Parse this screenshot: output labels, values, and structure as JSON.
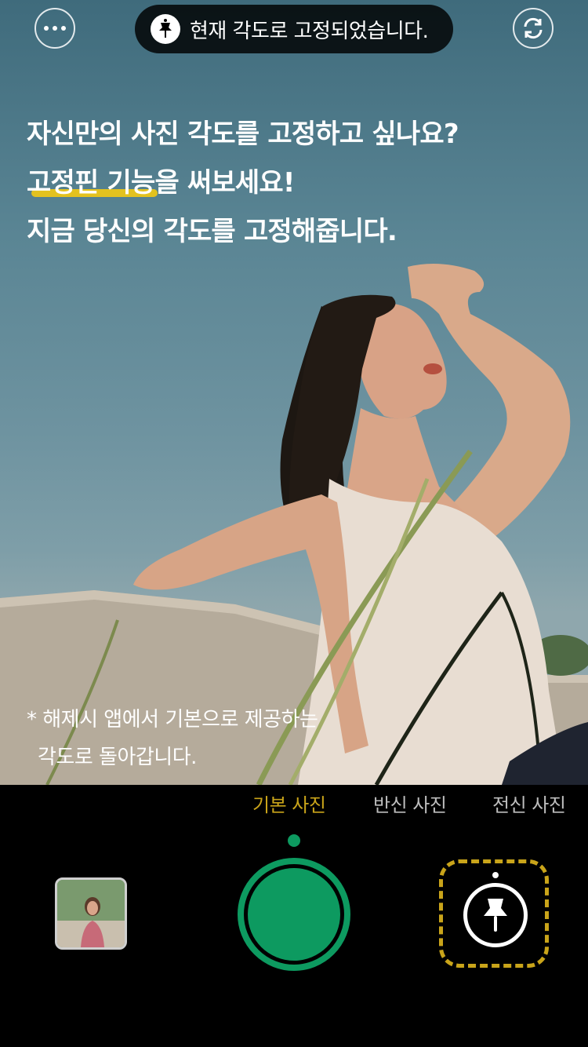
{
  "toast": {
    "icon": "pin-icon",
    "text": "현재 각도로 고정되었습니다."
  },
  "top_bar": {
    "more_icon": "more-dots-icon",
    "flip_icon": "camera-flip-icon"
  },
  "headline": {
    "line1": "자신만의 사진 각도를 고정하고 싶나요?",
    "line2_highlight": "고정핀 기능",
    "line2_rest": "을 써보세요!",
    "line3": "지금 당신의 각도를 고정해줍니다.",
    "highlight_color": "#e3c21f"
  },
  "note": {
    "line1": "* 해제시 앱에서 기본으로 제공하는",
    "line2": "각도로 돌아갑니다."
  },
  "modes": [
    {
      "label": "기본 사진",
      "active": true
    },
    {
      "label": "반신 사진",
      "active": false
    },
    {
      "label": "전신 사진",
      "active": false
    }
  ],
  "colors": {
    "accent_green": "#0d9a60",
    "accent_gold": "#c9a41a",
    "background": "#000000"
  },
  "controls": {
    "gallery_icon": "gallery-thumbnail",
    "shutter_icon": "shutter-button",
    "pin_icon": "pin-icon"
  }
}
